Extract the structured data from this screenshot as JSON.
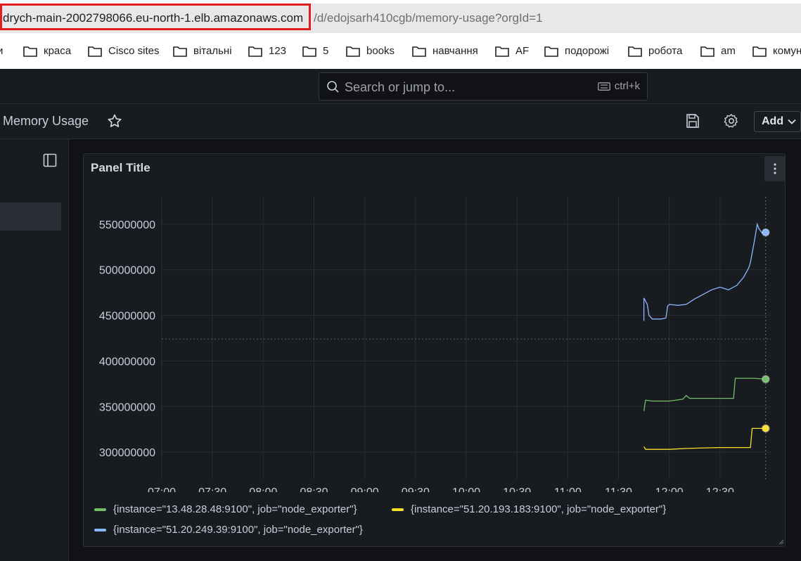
{
  "browser": {
    "url_host": "drych-main-2002798066.eu-north-1.elb.amazonaws.com",
    "url_path": "/d/edojsarh410cgb/memory-usage?orgId=1",
    "bookmarks": [
      "и",
      "краса",
      "Cisco sites",
      "вітальні",
      "123",
      "5",
      "books",
      "навчання",
      "AF",
      "подорожі",
      "робота",
      "am",
      "комун"
    ]
  },
  "topnav": {
    "search_placeholder": "Search or jump to...",
    "shortcut": "ctrl+k"
  },
  "toolbar": {
    "dashboard_title": "Memory Usage",
    "add_label": "Add"
  },
  "panel": {
    "title": "Panel Title"
  },
  "chart_data": {
    "type": "line",
    "title": "Panel Title",
    "xlabel": "",
    "ylabel": "",
    "x_ticks": [
      "07:00",
      "07:30",
      "08:00",
      "08:30",
      "09:00",
      "09:30",
      "10:00",
      "10:30",
      "11:00",
      "11:30",
      "12:00",
      "12:30"
    ],
    "y_ticks": [
      300000000,
      350000000,
      400000000,
      450000000,
      500000000,
      550000000
    ],
    "ylim": [
      270000000,
      580000000
    ],
    "grid": true,
    "legend_position": "bottom",
    "series": [
      {
        "name": "{instance=\"13.48.28.48:9100\", job=\"node_exporter\"}",
        "color": "#73bf69",
        "points": [
          [
            "11:45",
            345000000
          ],
          [
            "11:46",
            357000000
          ],
          [
            "11:50",
            356000000
          ],
          [
            "12:00",
            356000000
          ],
          [
            "12:08",
            358000000
          ],
          [
            "12:10",
            362000000
          ],
          [
            "12:12",
            359000000
          ],
          [
            "12:20",
            359000000
          ],
          [
            "12:38",
            359000000
          ],
          [
            "12:39",
            381000000
          ],
          [
            "12:50",
            381000000
          ],
          [
            "12:57",
            380000000
          ]
        ]
      },
      {
        "name": "{instance=\"51.20.193.183:9100\", job=\"node_exporter\"}",
        "color": "#fade2a",
        "points": [
          [
            "11:45",
            306000000
          ],
          [
            "11:46",
            303000000
          ],
          [
            "12:00",
            303000000
          ],
          [
            "12:10",
            304000000
          ],
          [
            "12:30",
            305000000
          ],
          [
            "12:40",
            305000000
          ],
          [
            "12:48",
            305000000
          ],
          [
            "12:49",
            326000000
          ],
          [
            "12:57",
            326000000
          ]
        ]
      },
      {
        "name": "{instance=\"51.20.249.39:9100\", job=\"node_exporter\"}",
        "color": "#8ab8ff",
        "points": [
          [
            "11:45",
            444000000
          ],
          [
            "11:45",
            469000000
          ],
          [
            "11:47",
            462000000
          ],
          [
            "11:48",
            450000000
          ],
          [
            "11:50",
            446000000
          ],
          [
            "11:55",
            446000000
          ],
          [
            "11:58",
            447000000
          ],
          [
            "11:59",
            460000000
          ],
          [
            "12:00",
            462000000
          ],
          [
            "12:05",
            461000000
          ],
          [
            "12:10",
            462000000
          ],
          [
            "12:15",
            468000000
          ],
          [
            "12:20",
            473000000
          ],
          [
            "12:25",
            478000000
          ],
          [
            "12:30",
            481000000
          ],
          [
            "12:35",
            478000000
          ],
          [
            "12:40",
            483000000
          ],
          [
            "12:44",
            492000000
          ],
          [
            "12:47",
            502000000
          ],
          [
            "12:48",
            508000000
          ],
          [
            "12:50",
            528000000
          ],
          [
            "12:52",
            550000000
          ],
          [
            "12:53",
            545000000
          ],
          [
            "12:55",
            540000000
          ],
          [
            "12:57",
            541000000
          ]
        ]
      }
    ],
    "threshold_dashed_line": 424000000
  }
}
